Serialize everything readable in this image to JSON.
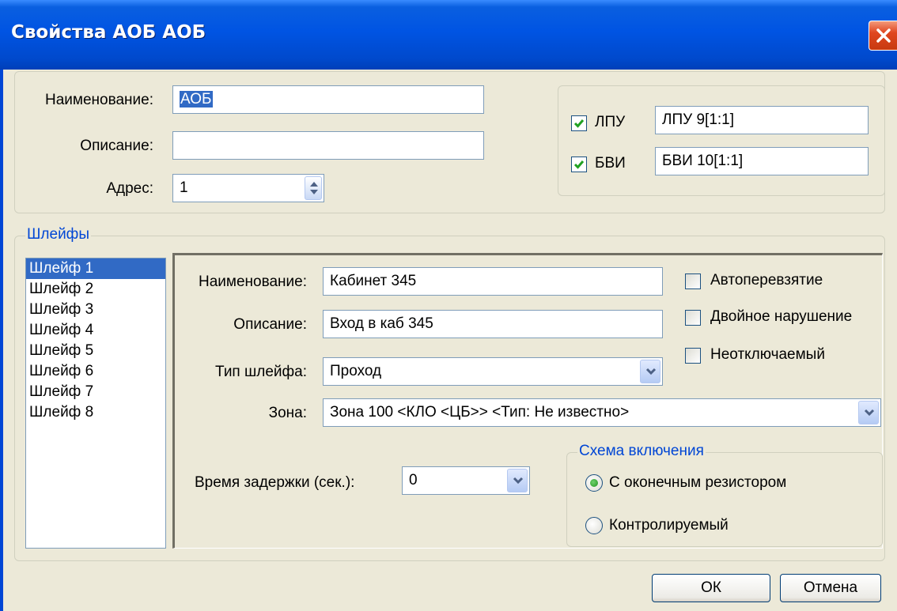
{
  "window": {
    "title": "Свойства АОБ АОБ"
  },
  "device": {
    "name_label": "Наименование:",
    "name_value": "АОБ",
    "description_label": "Описание:",
    "description_value": "",
    "address_label": "Адрес:",
    "address_value": "1"
  },
  "links": {
    "lpu_label": "ЛПУ",
    "lpu_checked": true,
    "lpu_value": "ЛПУ 9[1:1]",
    "bvi_label": "БВИ",
    "bvi_checked": true,
    "bvi_value": "БВИ 10[1:1]"
  },
  "loops": {
    "legend": "Шлейфы",
    "items": [
      "Шлейф 1",
      "Шлейф 2",
      "Шлейф 3",
      "Шлейф 4",
      "Шлейф 5",
      "Шлейф 6",
      "Шлейф 7",
      "Шлейф 8"
    ],
    "selected_index": 0
  },
  "loop_detail": {
    "name_label": "Наименование:",
    "name_value": "Кабинет 345",
    "description_label": "Описание:",
    "description_value": "Вход в каб 345",
    "type_label": "Тип шлейфа:",
    "type_value": "Проход",
    "zone_label": "Зона:",
    "zone_value": "Зона 100 <КЛО <ЦБ>>  <Тип: Не известно>",
    "delay_label": "Время задержки (сек.):",
    "delay_value": "0",
    "autorearm_label": "Автоперевзятие",
    "autorearm_checked": false,
    "double_violation_label": "Двойное нарушение",
    "double_violation_checked": false,
    "non_disconnectable_label": "Неотключаемый",
    "non_disconnectable_checked": false
  },
  "scheme": {
    "legend": "Схема включения",
    "option_resistor": "С оконечным резистором",
    "option_controlled": "Контролируемый",
    "selected": "С оконечным резистором"
  },
  "buttons": {
    "ok": "ОК",
    "cancel": "Отмена"
  },
  "colors": {
    "titlebar": "#0054e3",
    "accent": "#0046d5",
    "selection": "#316ac5",
    "check": "#21a121"
  }
}
